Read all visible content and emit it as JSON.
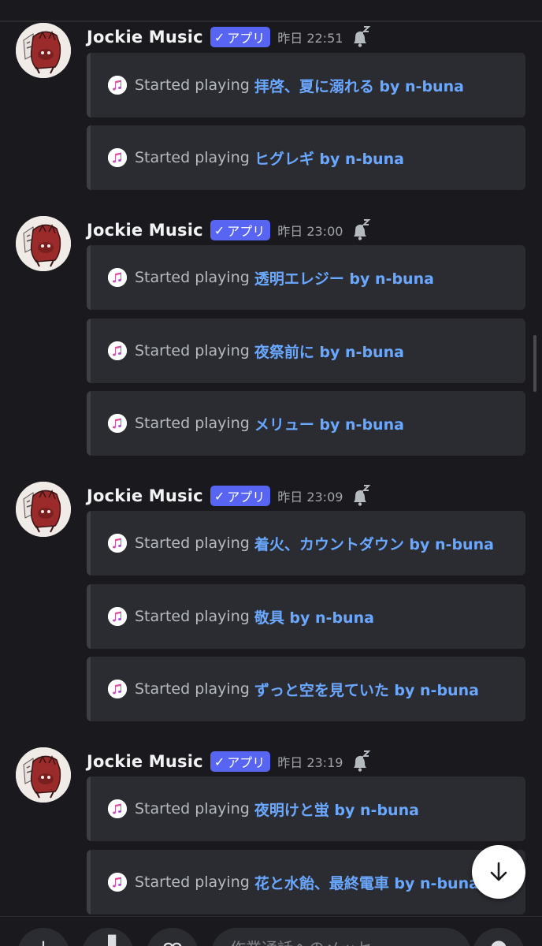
{
  "groups": [
    {
      "username": "Jockie Music",
      "app_tag": "アプリ",
      "timestamp": "昨日 22:51",
      "embeds": [
        {
          "prefix": "Started playing",
          "song": "拝啓、夏に溺れる by n-buna"
        },
        {
          "prefix": "Started playing",
          "song": "ヒグレギ by n-buna"
        }
      ]
    },
    {
      "username": "Jockie Music",
      "app_tag": "アプリ",
      "timestamp": "昨日 23:00",
      "embeds": [
        {
          "prefix": "Started playing",
          "song": "透明エレジー by n-buna"
        },
        {
          "prefix": "Started playing",
          "song": "夜祭前に by n-buna"
        },
        {
          "prefix": "Started playing",
          "song": "メリュー by n-buna"
        }
      ]
    },
    {
      "username": "Jockie Music",
      "app_tag": "アプリ",
      "timestamp": "昨日 23:09",
      "embeds": [
        {
          "prefix": "Started playing",
          "song": "着火、カウントダウン by n-buna"
        },
        {
          "prefix": "Started playing",
          "song": "敬具 by n-buna"
        },
        {
          "prefix": "Started playing",
          "song": "ずっと空を見ていた by n-buna"
        }
      ]
    },
    {
      "username": "Jockie Music",
      "app_tag": "アプリ",
      "timestamp": "昨日 23:19",
      "embeds": [
        {
          "prefix": "Started playing",
          "song": "夜明けと蛍 by n-buna"
        },
        {
          "prefix": "Started playing",
          "song": "花と水飴、最終電車 by n-buna"
        }
      ]
    }
  ],
  "icons": {
    "app_tag_check": "checkmark-icon",
    "snooze": "bell-snooze-icon",
    "embed": "apple-music-icon",
    "scroll_down": "arrow-down-icon"
  },
  "colors": {
    "background": "#1a1a1e",
    "embed_bg": "#2b2c31",
    "app_tag": "#5865f2",
    "song_link": "#6aa7ff",
    "avatar_red": "#9b2a2a"
  },
  "composer": {
    "placeholder": "作業通話へのメッセ"
  }
}
